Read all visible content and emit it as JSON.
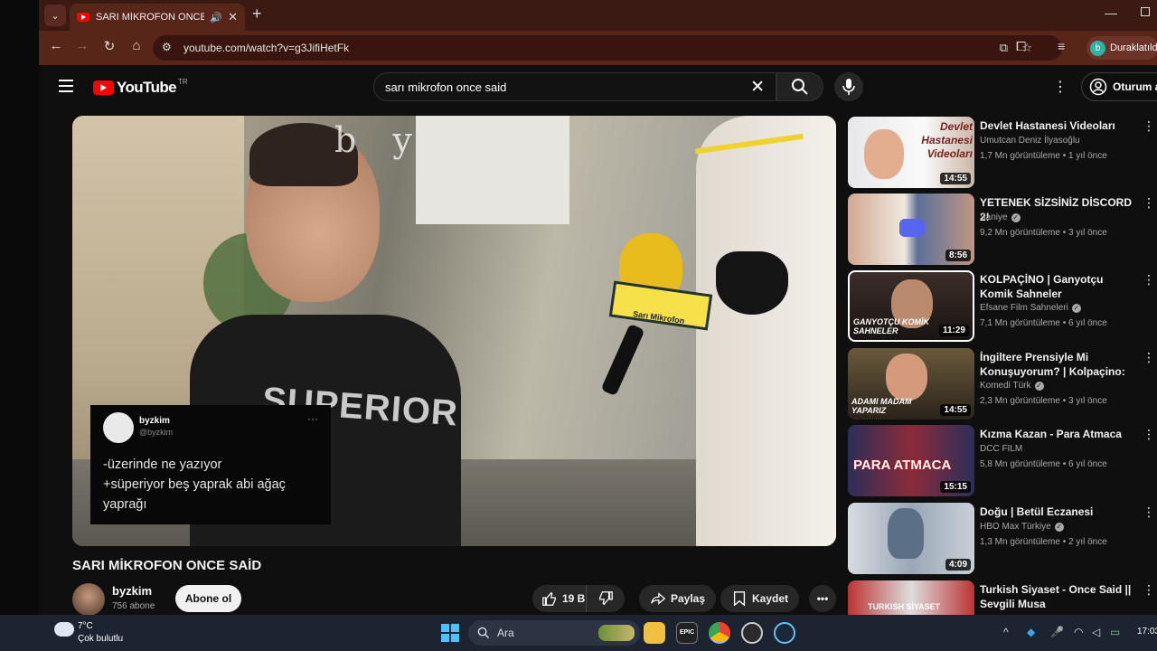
{
  "browser": {
    "tab_title": "SARI MİKROFON ONCE SAİD",
    "url": "youtube.com/watch?v=g3JifiHetFk",
    "profile_initial": "b",
    "profile_status": "Duraklatıldı"
  },
  "youtube": {
    "logo_text": "YouTube",
    "logo_country": "TR",
    "search_query": "sarı mikrofon once said",
    "signin_label": "Oturum aç"
  },
  "video": {
    "watermark": "b y",
    "shirt_text": "SUPERIOR",
    "mic_text": "Sarı Mikrofon",
    "overlay": {
      "name": "byzkim",
      "handle": "@byzkim",
      "line1": "-üzerinde ne yazıyor",
      "line2": "+süperiyor beş yaprak abi ağaç yaprağı"
    },
    "title": "SARI MİKROFON ONCE SAİD",
    "channel": "byzkim",
    "subscribers": "756 abone",
    "subscribe_label": "Abone ol",
    "likes": "19 B",
    "share_label": "Paylaş",
    "save_label": "Kaydet"
  },
  "recommendations": [
    {
      "title": "Devlet Hastanesi Videoları",
      "channel": "Umutcan Deniz İlyasoğlu",
      "meta": "1,7 Mn görüntüleme • 1 yıl önce",
      "duration": "14:55",
      "verified": false,
      "thumb_caption": "Devlet Hastanesi Videoları"
    },
    {
      "title": "YETENEK SİZSİNİZ DİSCORD 2!",
      "channel": "Saniye",
      "meta": "9,2 Mn görüntüleme • 3 yıl önce",
      "duration": "8:56",
      "verified": true,
      "thumb_caption": ""
    },
    {
      "title": "KOLPAÇİNO | Ganyotçu Komik Sahneler",
      "channel": "Efsane Film Sahneleri",
      "meta": "7,1 Mn görüntüleme • 6 yıl önce",
      "duration": "11:29",
      "verified": true,
      "thumb_caption": "GANYOTÇU KOMİK SAHNELER"
    },
    {
      "title": "İngiltere Prensiyle Mi Konuşuyorum? | Kolpaçino: ...",
      "channel": "Komedi Türk",
      "meta": "2,3 Mn görüntüleme • 3 yıl önce",
      "duration": "14:55",
      "verified": true,
      "thumb_caption": "ADAMI MADAM YAPARIZ"
    },
    {
      "title": "Kızma Kazan - Para Atmaca",
      "channel": "DCC FILM",
      "meta": "5,8 Mn görüntüleme • 6 yıl önce",
      "duration": "15:15",
      "verified": false,
      "thumb_caption": "PARA ATMACA"
    },
    {
      "title": "Doğu | Betül Eczanesi",
      "channel": "HBO Max Türkiye",
      "meta": "1,3 Mn görüntüleme • 2 yıl önce",
      "duration": "4:09",
      "verified": true,
      "thumb_caption": ""
    },
    {
      "title": "Turkish Siyaset - Once Said || Sevgili Musa",
      "channel": "",
      "meta": "",
      "duration": "",
      "verified": false,
      "thumb_caption": "TURKISH SİYASET"
    }
  ],
  "taskbar": {
    "temperature": "7°C",
    "weather": "Çok bulutlu",
    "search_label": "Ara",
    "time": "17:03"
  },
  "colors": {
    "yt_red": "#ff0000",
    "browser_frame": "#582619",
    "page_bg": "#0f0f0f"
  }
}
